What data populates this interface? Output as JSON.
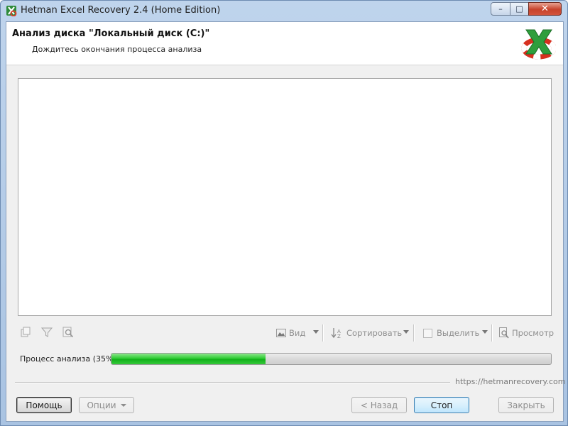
{
  "window": {
    "title": "Hetman Excel Recovery 2.4 (Home Edition)",
    "controls": {
      "minimize": "–",
      "maximize": "□",
      "close": "✕"
    }
  },
  "header": {
    "title": "Анализ диска \"Локальный диск (C:)\"",
    "subtitle": "Дождитесь окончания процесса анализа"
  },
  "toolbar": {
    "left_icons": [
      "copy-icon",
      "filter-icon",
      "find-icon"
    ],
    "view_label": "Вид",
    "sort_label": "Сортировать",
    "select_label": "Выделить",
    "preview_label": "Просмотр"
  },
  "progress": {
    "label": "Процесс анализа (35%)",
    "percent": 35
  },
  "footer": {
    "url": "https://hetmanrecovery.com"
  },
  "buttons": {
    "help": "Помощь",
    "options": "Опции",
    "back": "< Назад",
    "stop": "Стоп",
    "close": "Закрыть"
  },
  "colors": {
    "progress_green": "#22c02a",
    "title_bar": "#b9d1ea"
  }
}
